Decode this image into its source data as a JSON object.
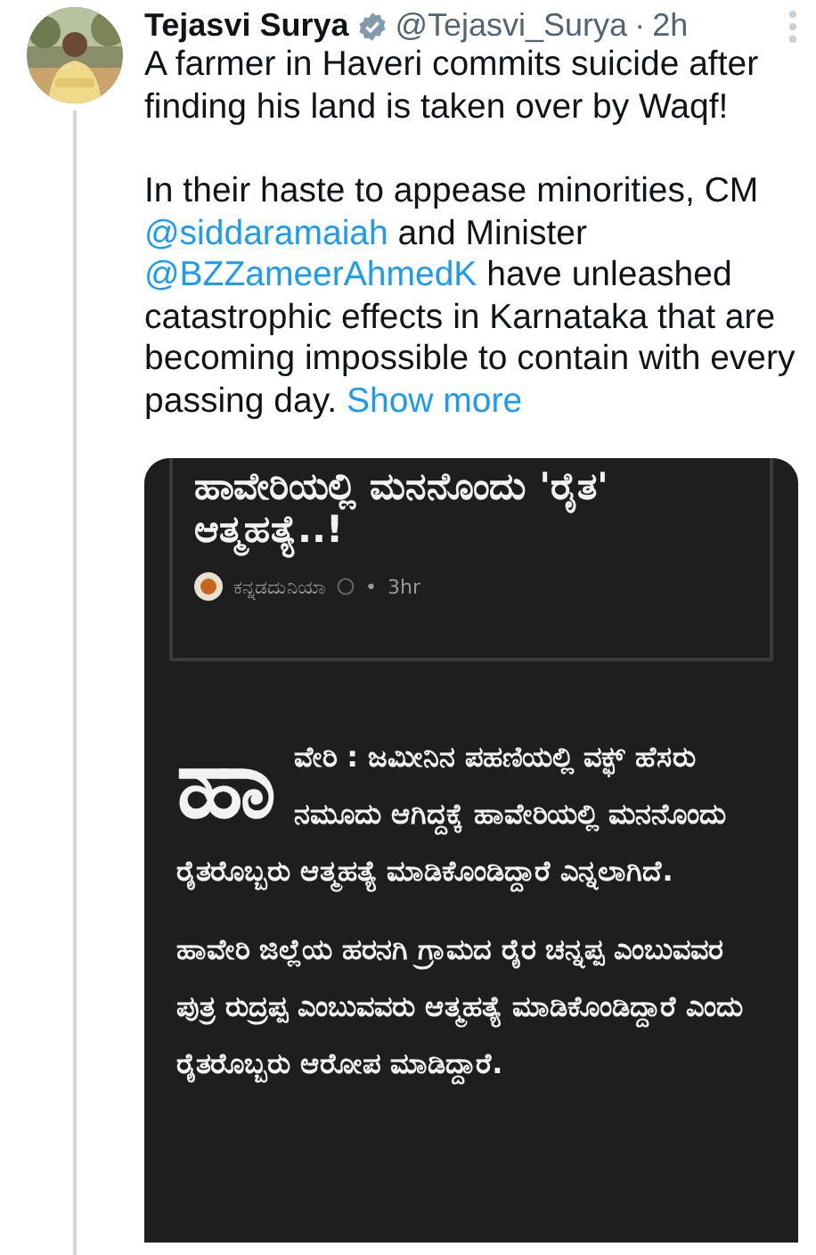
{
  "tweet": {
    "author": {
      "name": "Tejasvi Surya",
      "verified": true,
      "handle": "@Tejasvi_Surya",
      "separator": "·",
      "time": "2h"
    },
    "paragraphs": [
      [
        {
          "kind": "text",
          "text": "A farmer in Haveri commits suicide after finding his land is taken over by Waqf!"
        }
      ],
      [
        {
          "kind": "text",
          "text": "In their haste to appease minorities, CM "
        },
        {
          "kind": "mention",
          "text": "@siddaramaiah"
        },
        {
          "kind": "text",
          "text": " and Minister "
        },
        {
          "kind": "mention",
          "text": "@BZZameerAhmedK"
        },
        {
          "kind": "text",
          "text": " have unleashed catastrophic effects in Karnataka that are becoming impossible to contain with every passing day. "
        },
        {
          "kind": "link",
          "text": "Show more"
        }
      ]
    ],
    "media": {
      "headline": "ಹಾವೇರಿಯಲ್ಲಿ ಮನನೊಂದು 'ರೈತ' ಆತ್ಮಹತ್ಯೆ..!",
      "source": "ಕನ್ನಡದುನಿಯಾ",
      "source_verified": true,
      "source_separator": "•",
      "time": "3hr",
      "drop_cap": "ಹಾ",
      "paragraphs": [
        "ವೇರಿ : ಜಮೀನಿನ ಪಹಣಿಯಲ್ಲಿ ವಕ್ಫ್ ಹೆಸರು ನಮೂದು ಆಗಿದ್ದಕ್ಕೆ ಹಾವೇರಿಯಲ್ಲಿ ಮನನೊಂದು ರೈತರೊಬ್ಬರು ಆತ್ಮಹತ್ಯೆ ಮಾಡಿಕೊಂಡಿದ್ದಾರೆ ಎನ್ನಲಾಗಿದೆ.",
        "ಹಾವೇರಿ ಜಿಲ್ಲೆಯ ಹರನಗಿ ಗ್ರಾಮದ ರೈರ ಚನ್ನಪ್ಪ ಎಂಬುವವರ ಪುತ್ರ ರುದ್ರಪ್ಪ ಎಂಬುವವರು ಆತ್ಮಹತ್ಯೆ ಮಾಡಿಕೊಂಡಿದ್ದಾರೆ ಎಂದು ರೈತರೊಬ್ಬರು ಆರೋಪ ಮಾಡಿದ್ದಾರೆ."
      ]
    }
  }
}
